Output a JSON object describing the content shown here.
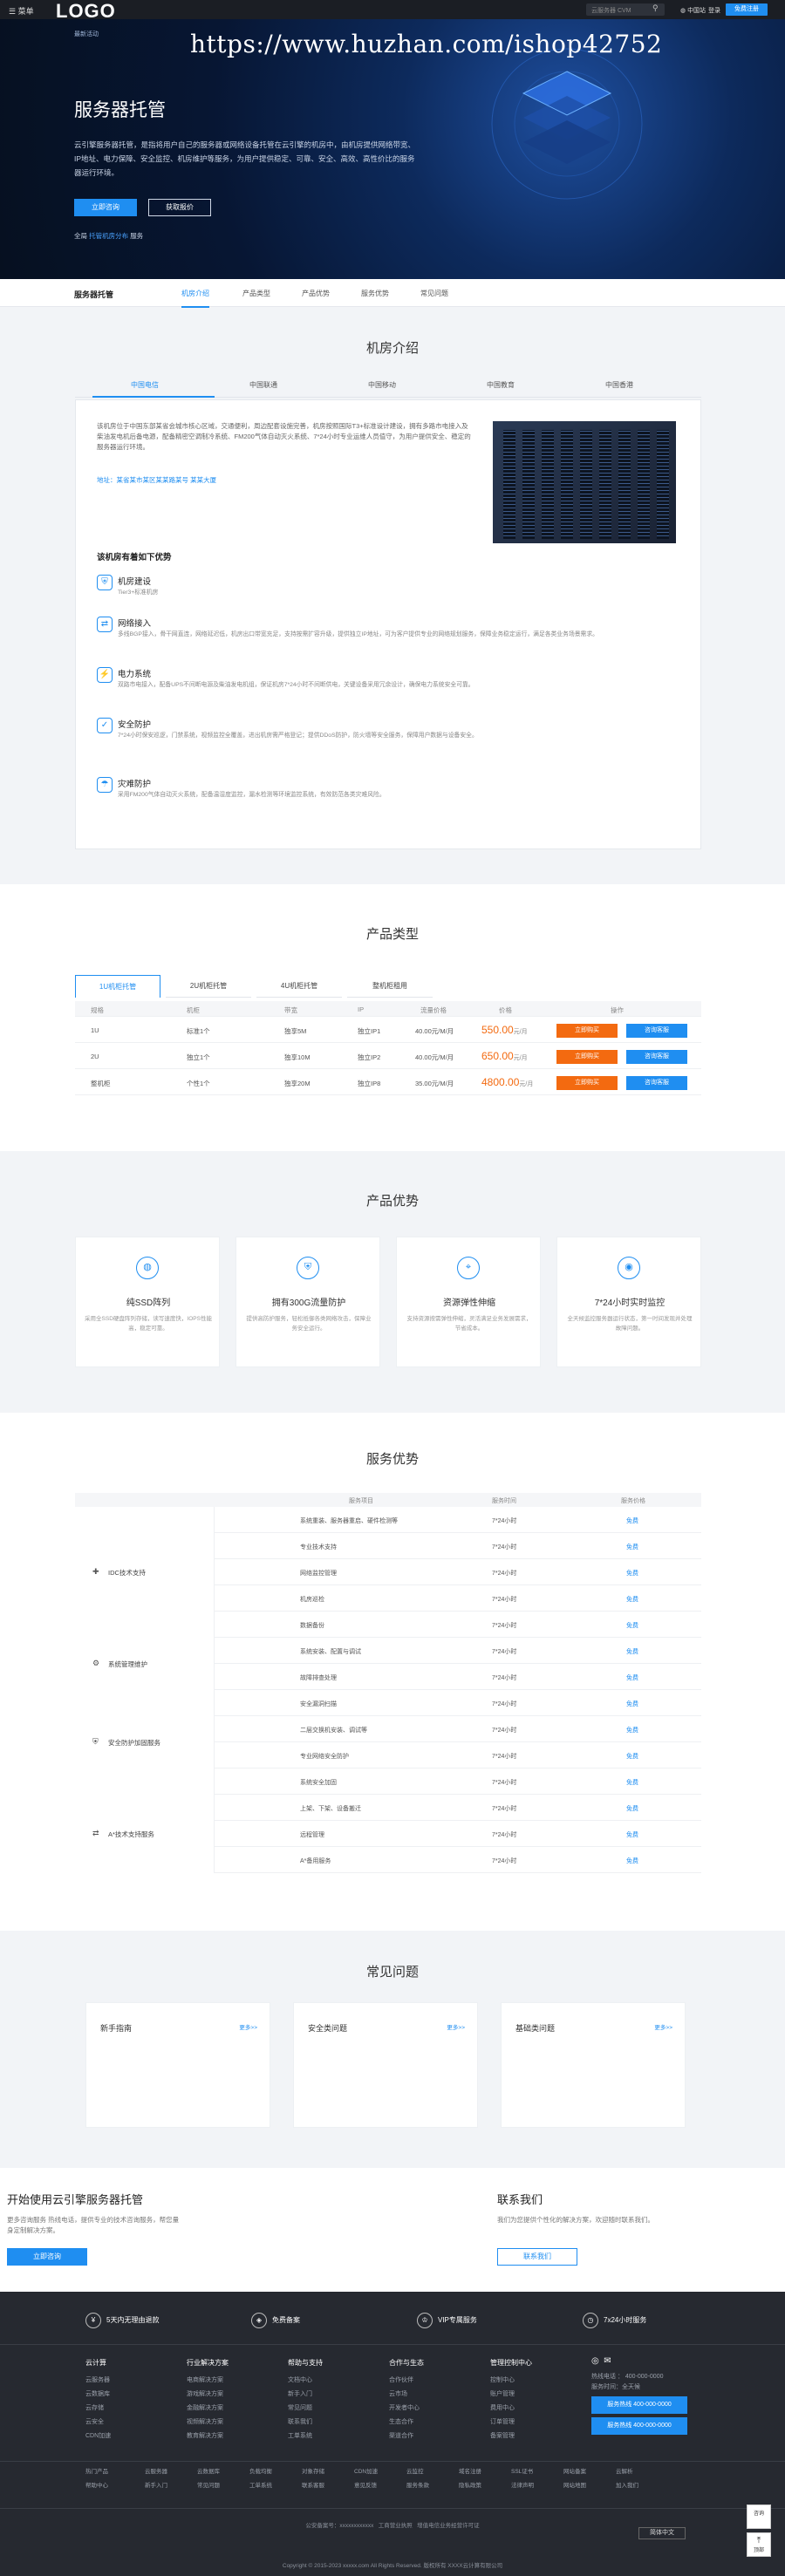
{
  "topbar": {
    "menu": "菜单",
    "logo": "LOGO",
    "search_placeholder": "云服务器 CVM",
    "region": "中国站",
    "links": [
      "备案",
      "控制台"
    ],
    "login": "登录",
    "register": "免费注册"
  },
  "watermark": "https://www.huzhan.com/ishop42752",
  "hero": {
    "tag": "最新活动",
    "title": "服务器托管",
    "desc": "云引擎服务器托管，是指将用户自己的服务器或网络设备托管在云引擎的机房中，由机房提供网络带宽、IP地址、电力保障、安全监控、机房维护等服务，为用户提供稳定、可靠、安全、高效、高性价比的服务器运行环境。",
    "btn_primary": "立即咨询",
    "btn_secondary": "获取报价",
    "note_prefix": "全局",
    "note_link": "托管机房分布",
    "note_suffix": "服务"
  },
  "subnav": {
    "title": "服务器托管",
    "items": [
      "机房介绍",
      "产品类型",
      "产品优势",
      "服务优势",
      "常见问题"
    ]
  },
  "idc": {
    "title": "机房介绍",
    "tabs": [
      "中国电信",
      "中国联通",
      "中国移动",
      "中国教育",
      "中国香港"
    ],
    "intro": "该机房位于中国东部某省会城市核心区域，交通便利，周边配套设施完善，机房按照国际T3+标准设计建设，拥有多路市电接入及柴油发电机后备电源，配备精密空调制冷系统、FM200气体自动灭火系统、7*24小时专业运维人员值守，为用户提供安全、稳定的服务器运行环境。",
    "address": "地址：某省某市某区某某路某号 某某大厦",
    "question": "该机房有着如下优势",
    "features": [
      {
        "icon": "shield-icon",
        "glyph": "⛨",
        "title": "机房建设",
        "desc": "Tier3+标准机房"
      },
      {
        "icon": "network-icon",
        "glyph": "⇄",
        "title": "网络接入",
        "desc": "多线BGP接入，骨干网直连，网络延迟低，机房出口带宽充足，支持按需扩容升级，提供独立IP地址，可为客户提供专业的网络规划服务，保障业务稳定运行，满足各类业务场景需求。"
      },
      {
        "icon": "power-icon",
        "glyph": "⚡",
        "title": "电力系统",
        "desc": "双路市电接入，配备UPS不间断电源及柴油发电机组，保证机房7*24小时不间断供电，关键设备采用冗余设计，确保电力系统安全可靠。"
      },
      {
        "icon": "security-icon",
        "glyph": "✓",
        "title": "安全防护",
        "desc": "7*24小时保安巡逻，门禁系统，视频监控全覆盖，进出机房需严格登记；提供DDoS防护，防火墙等安全服务，保障用户数据与设备安全。"
      },
      {
        "icon": "disaster-icon",
        "glyph": "☂",
        "title": "灾难防护",
        "desc": "采用FM200气体自动灭火系统，配备温湿度监控，漏水检测等环境监控系统，有效防范各类灾难风险。"
      }
    ]
  },
  "products": {
    "title": "产品类型",
    "tabs": [
      "1U机柜托管",
      "2U机柜托管",
      "4U机柜托管",
      "整机柜租用"
    ],
    "headers": [
      "规格",
      "机柜",
      "带宽",
      "IP",
      "流量价格",
      "价格",
      "操作"
    ],
    "rows": [
      {
        "spec": "1U",
        "cabinet": "标准1个",
        "bandwidth": "独享5M",
        "ip": "独立IP1",
        "traffic": "40.00元/M/月",
        "price": "550.00",
        "unit": "元/月",
        "buy": "立即购买",
        "consult": "咨询客服"
      },
      {
        "spec": "2U",
        "cabinet": "独立1个",
        "bandwidth": "独享10M",
        "ip": "独立IP2",
        "traffic": "40.00元/M/月",
        "price": "650.00",
        "unit": "元/月",
        "buy": "立即购买",
        "consult": "咨询客服"
      },
      {
        "spec": "整机柜",
        "cabinet": "个性1个",
        "bandwidth": "独享20M",
        "ip": "独立IP8",
        "traffic": "35.00元/M/月",
        "price": "4800.00",
        "unit": "元/月",
        "buy": "立即购买",
        "consult": "咨询客服"
      }
    ]
  },
  "advantages": {
    "title": "产品优势",
    "items": [
      {
        "icon": "globe-icon",
        "glyph": "◍",
        "title": "纯SSD阵列",
        "desc": "采用全SSD硬盘阵列存储，读写速度快，IOPS性能高，稳定可靠。"
      },
      {
        "icon": "shield-icon",
        "glyph": "⛨",
        "title": "拥有300G流量防护",
        "desc": "提供高防护服务，轻松抵御各类网络攻击，保障业务安全运行。"
      },
      {
        "icon": "resource-icon",
        "glyph": "⌖",
        "title": "资源弹性伸缩",
        "desc": "支持资源按需弹性伸缩，灵活满足业务发展需求，节省成本。"
      },
      {
        "icon": "monitor-icon",
        "glyph": "◉",
        "title": "7*24小时实时监控",
        "desc": "全天候监控服务器运行状态，第一时间发现并处理故障问题。"
      }
    ]
  },
  "service": {
    "title": "服务优势",
    "headers": [
      "服务项目",
      "服务时间",
      "服务价格"
    ],
    "groups": [
      {
        "icon": "tech-support-icon",
        "glyph": "✚",
        "label": "IDC技术支持",
        "rows": [
          [
            "系统重装、服务器重启、硬件检测等",
            "7*24小时",
            "免费"
          ],
          [
            "专业技术支持",
            "7*24小时",
            "免费"
          ],
          [
            "网络监控管理",
            "7*24小时",
            "免费"
          ],
          [
            "机房巡检",
            "7*24小时",
            "免费"
          ],
          [
            "数据备份",
            "7*24小时",
            "免费"
          ]
        ]
      },
      {
        "icon": "ops-icon",
        "glyph": "⚙",
        "label": "系统管理维护",
        "rows": [
          [
            "系统安装、配置与调试",
            "7*24小时",
            "免费"
          ],
          [
            "故障排查处理",
            "7*24小时",
            "免费"
          ]
        ]
      },
      {
        "icon": "security-icon",
        "glyph": "⛨",
        "label": "安全防护加固服务",
        "rows": [
          [
            "安全漏洞扫描",
            "7*24小时",
            "免费"
          ],
          [
            "二层交换机安装、调试等",
            "7*24小时",
            "免费"
          ],
          [
            "专业网络安全防护",
            "7*24小时",
            "免费"
          ],
          [
            "系统安全加固",
            "7*24小时",
            "免费"
          ]
        ]
      },
      {
        "icon": "network-icon",
        "glyph": "⇄",
        "label": "A*技术支持服务",
        "rows": [
          [
            "上架、下架、设备搬迁",
            "7*24小时",
            "免费"
          ],
          [
            "远程管理",
            "7*24小时",
            "免费"
          ],
          [
            "A*备用服务",
            "7*24小时",
            "免费"
          ]
        ]
      }
    ]
  },
  "faq": {
    "title": "常见问题",
    "more": "更多>>",
    "cards": [
      "新手指南",
      "安全类问题",
      "基础类问题"
    ]
  },
  "cta": {
    "left_title": "开始使用云引擎服务器托管",
    "left_desc": "更多咨询服务 热线电话，提供专业的技术咨询服务，帮您量身定制解决方案。",
    "left_btn": "立即咨询",
    "right_title": "联系我们",
    "right_desc": "我们为您提供个性化的解决方案，欢迎随时联系我们。",
    "right_btn": "联系我们"
  },
  "footer": {
    "promos": [
      "5天内无理由退款",
      "免费备案",
      "VIP专属服务",
      "7x24小时服务"
    ],
    "columns": [
      {
        "title": "云计算",
        "items": [
          "云服务器",
          "云数据库",
          "云存储",
          "云安全",
          "CDN加速"
        ]
      },
      {
        "title": "行业解决方案",
        "items": [
          "电商解决方案",
          "游戏解决方案",
          "金融解决方案",
          "视频解决方案",
          "教育解决方案"
        ]
      },
      {
        "title": "帮助与支持",
        "items": [
          "文档中心",
          "新手入门",
          "常见问题",
          "联系我们",
          "工单系统"
        ]
      },
      {
        "title": "合作与生态",
        "items": [
          "合作伙伴",
          "云市场",
          "开发者中心",
          "生态合作",
          "渠道合作"
        ]
      },
      {
        "title": "管理控制中心",
        "items": [
          "控制中心",
          "账户管理",
          "费用中心",
          "订单管理",
          "备案管理"
        ]
      }
    ],
    "contact": {
      "line1": "热线电话 ： 400-000-0000",
      "line2": "服务时间：全天候",
      "box1": "服务热线 400-000-0000",
      "box2": "服务热线 400-000-0000"
    },
    "products_label": "热门产品",
    "products": [
      "云服务器",
      "云数据库",
      "负载均衡",
      "对象存储",
      "CDN加速",
      "云监控",
      "域名注册",
      "SSL证书",
      "网站备案",
      "云解析"
    ],
    "help_label": "帮助中心",
    "help": [
      "新手入门",
      "常见问题",
      "工单系统",
      "联系客服",
      "意见反馈",
      "服务条款",
      "隐私政策",
      "法律声明",
      "网站地图",
      "加入我们"
    ],
    "license1": "公安备案号：xxxxxxxxxxxx",
    "license2": "工商营业执照",
    "license3": "增值电信业务经营许可证",
    "copyright": "Copyright © 2015-2023 xxxxx.com All Rights Reserved. 版权所有 XXXX云计算有限公司",
    "lang": "简体中文",
    "side1": "咨询",
    "side2": "顶部"
  }
}
